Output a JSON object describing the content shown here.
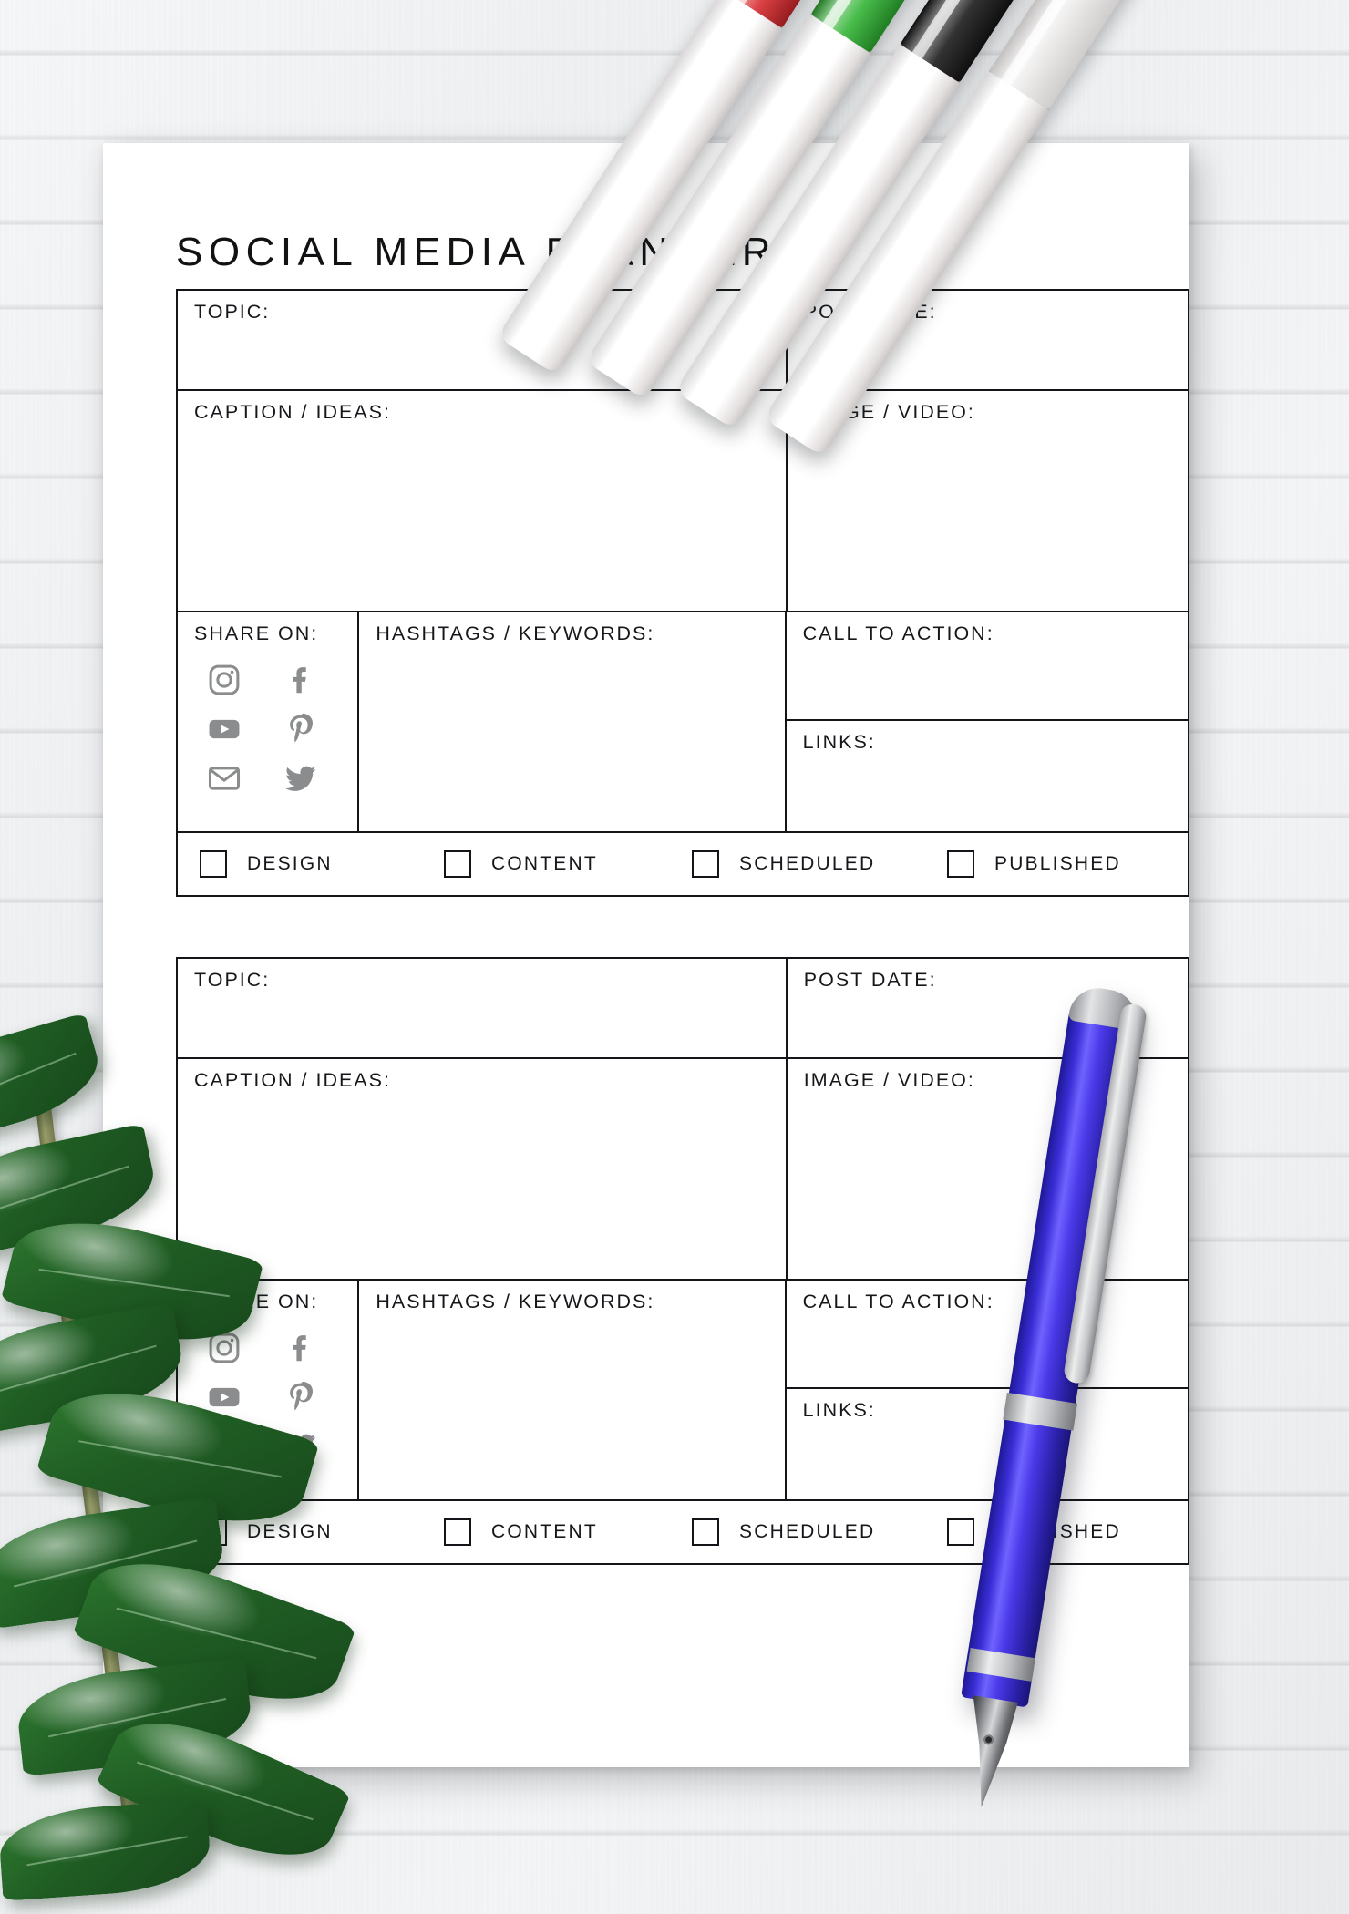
{
  "page": {
    "title": "SOCIAL MEDIA PLANNER"
  },
  "labels": {
    "topic": "TOPIC:",
    "post_date": "POST DATE:",
    "caption_ideas": "CAPTION / IDEAS:",
    "image_video": "IMAGE / VIDEO:",
    "share_on": "SHARE ON:",
    "hashtags_keywords": "HASHTAGS / KEYWORDS:",
    "call_to_action": "CALL TO ACTION:",
    "links": "LINKS:"
  },
  "social_icons": [
    {
      "name": "instagram-icon",
      "label": "Instagram"
    },
    {
      "name": "facebook-icon",
      "label": "Facebook"
    },
    {
      "name": "youtube-icon",
      "label": "YouTube"
    },
    {
      "name": "pinterest-icon",
      "label": "Pinterest"
    },
    {
      "name": "email-icon",
      "label": "Email"
    },
    {
      "name": "twitter-icon",
      "label": "Twitter"
    }
  ],
  "status_checkboxes": [
    {
      "label": "DESIGN",
      "checked": false
    },
    {
      "label": "CONTENT",
      "checked": false
    },
    {
      "label": "SCHEDULED",
      "checked": false
    },
    {
      "label": "PUBLISHED",
      "checked": false
    }
  ],
  "blocks": [
    {
      "id": "planner-block-1"
    },
    {
      "id": "planner-block-2"
    }
  ],
  "colors": {
    "ink": "#141518",
    "text": "#16171a",
    "icon_grey": "#8a8c8e",
    "paper": "#ffffff",
    "marker_red": "#d7282b",
    "marker_green": "#2fb332",
    "marker_black": "#161616",
    "marker_white": "#f1efee",
    "pen_blue": "#3a2ed6",
    "leaf_green": "#1f5c23"
  },
  "props": [
    {
      "name": "marker-pens",
      "count": 4
    },
    {
      "name": "fountain-pen",
      "count": 1
    },
    {
      "name": "zz-plant-branch",
      "count": 1
    }
  ]
}
